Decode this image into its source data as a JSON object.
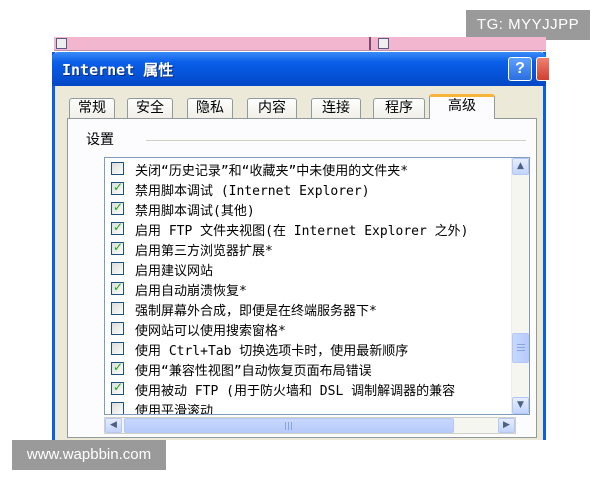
{
  "watermarks": {
    "top": "TG: MYYJJPP",
    "bottom": "www.wapbbin.com"
  },
  "window": {
    "title": "Internet 属性",
    "help_label": "?"
  },
  "tabs": [
    "常规",
    "安全",
    "隐私",
    "内容",
    "连接",
    "程序",
    "高级"
  ],
  "active_tab": "高级",
  "settings": {
    "group_label": "设置",
    "items": [
      {
        "label": "关闭“历史记录”和“收藏夹”中未使用的文件夹*",
        "checked": false
      },
      {
        "label": "禁用脚本调试 (Internet Explorer)",
        "checked": true
      },
      {
        "label": "禁用脚本调试(其他)",
        "checked": true
      },
      {
        "label": "启用 FTP 文件夹视图(在 Internet Explorer 之外)",
        "checked": true
      },
      {
        "label": "启用第三方浏览器扩展*",
        "checked": true
      },
      {
        "label": "启用建议网站",
        "checked": false
      },
      {
        "label": "启用自动崩溃恢复*",
        "checked": true
      },
      {
        "label": "强制屏幕外合成，即便是在终端服务器下*",
        "checked": false
      },
      {
        "label": "使网站可以使用搜索窗格*",
        "checked": false
      },
      {
        "label": "使用 Ctrl+Tab 切换选项卡时，使用最新顺序",
        "checked": false
      },
      {
        "label": "使用“兼容性视图”自动恢复页面布局错误",
        "checked": true
      },
      {
        "label": "使用被动 FTP (用于防火墙和 DSL 调制解调器的兼容",
        "checked": true
      },
      {
        "label": "使用平滑滚动",
        "checked": false
      }
    ]
  },
  "icons": {
    "scroll_up": "up-arrow-icon",
    "scroll_down": "down-arrow-icon",
    "scroll_left": "left-arrow-icon",
    "scroll_right": "right-arrow-icon",
    "check": "checkmark-icon"
  },
  "colors": {
    "title_bar": "#0a5ee8",
    "active_tab_accent": "#f9b43a",
    "check": "#21a121"
  }
}
